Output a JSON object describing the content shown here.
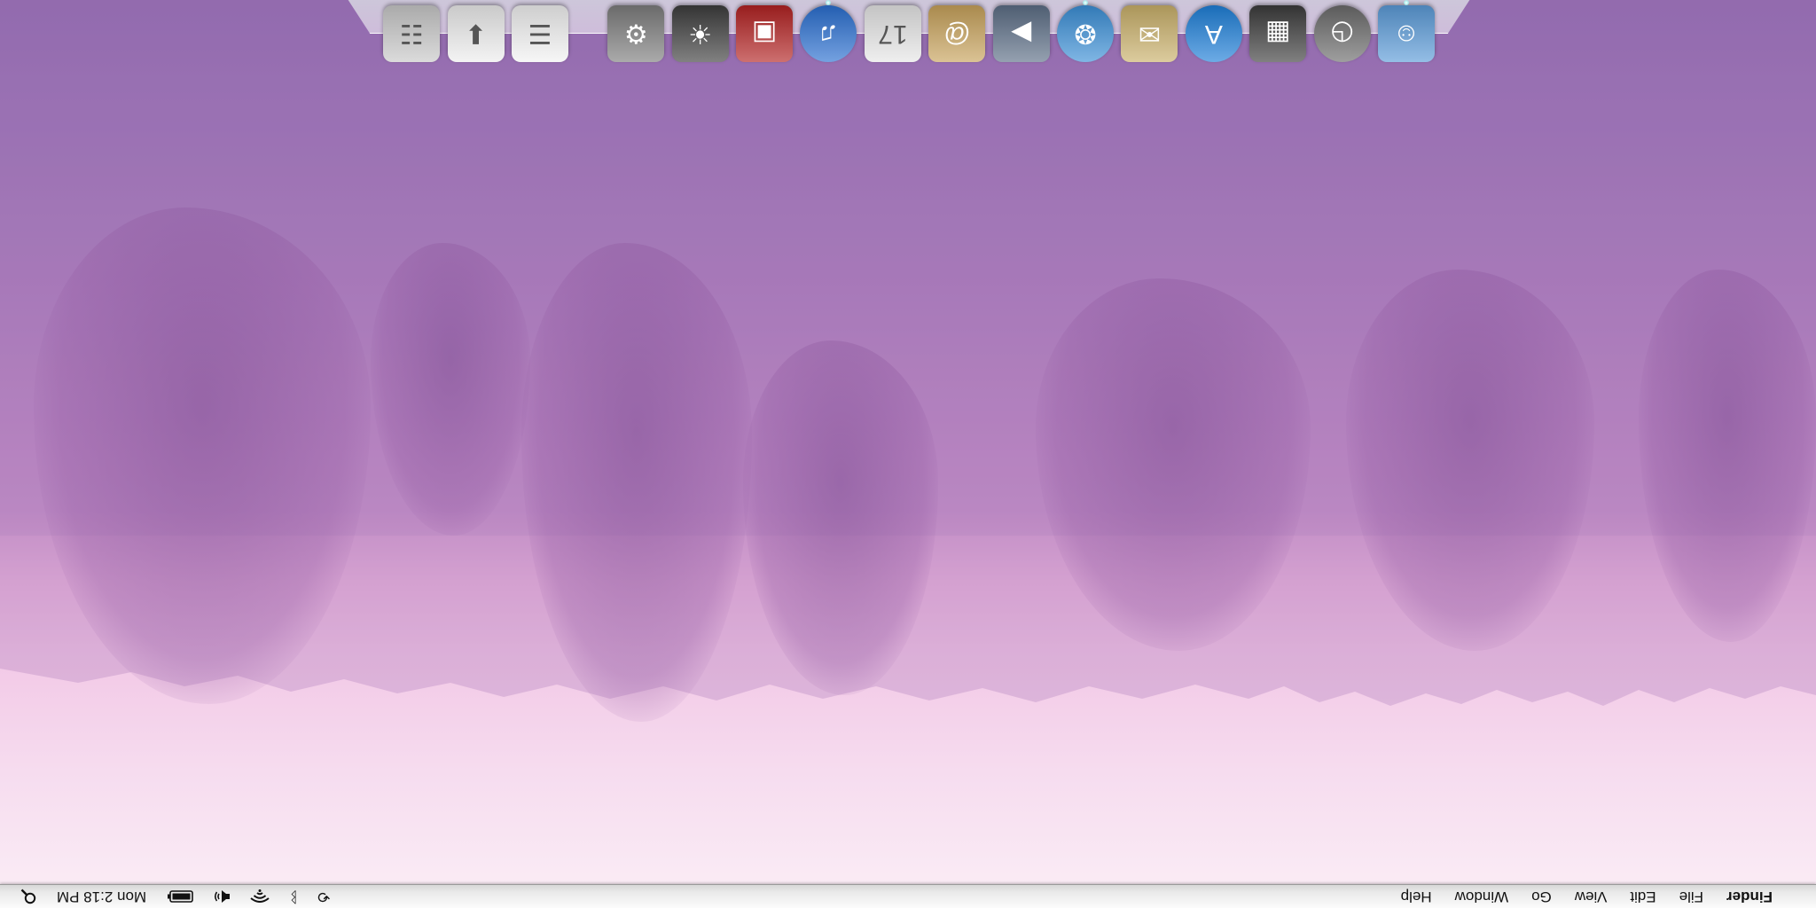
{
  "menubar": {
    "apple_glyph": "",
    "app_name": "Finder",
    "menus": [
      "File",
      "Edit",
      "View",
      "Go",
      "Window",
      "Help"
    ],
    "status": {
      "time_machine_glyph": "⟲",
      "bluetooth_glyph": "ᛒ",
      "wifi_glyph": "◡",
      "volume_glyph": "🔈",
      "battery_glyph": "▭",
      "clock": "Mon 2:18 PM",
      "spotlight_glyph": "⌕"
    }
  },
  "dock": {
    "apps": [
      {
        "name": "Finder",
        "glyph": "☺",
        "color": "#5b9bd8"
      },
      {
        "name": "Dashboard",
        "glyph": "◷",
        "color": "#6b6b6b"
      },
      {
        "name": "Mission Control",
        "glyph": "▦",
        "color": "#3c3c3c"
      },
      {
        "name": "App Store",
        "glyph": "A",
        "color": "#1e7fd8"
      },
      {
        "name": "Mail",
        "glyph": "✉",
        "color": "#c9b06a"
      },
      {
        "name": "Safari",
        "glyph": "❂",
        "color": "#3b8fd6"
      },
      {
        "name": "FaceTime",
        "glyph": "▶",
        "color": "#5c6e86"
      },
      {
        "name": "Contacts",
        "glyph": "@",
        "color": "#c7a25b"
      },
      {
        "name": "Calendar",
        "glyph": "17",
        "color": "#e6e6e6"
      },
      {
        "name": "iTunes",
        "glyph": "♫",
        "color": "#2a6fd0"
      },
      {
        "name": "Photo Booth",
        "glyph": "▣",
        "color": "#b22222"
      },
      {
        "name": "iPhoto",
        "glyph": "☀",
        "color": "#3d3d3d"
      },
      {
        "name": "System Preferences",
        "glyph": "⚙",
        "color": "#7d7d7d"
      }
    ],
    "docs": [
      {
        "name": "Documents stack",
        "glyph": "☰",
        "color": "#f2f2f2"
      },
      {
        "name": "Downloads stack",
        "glyph": "⬇",
        "color": "#ededed"
      },
      {
        "name": "Trash",
        "glyph": "☷",
        "color": "#c8c8c8"
      }
    ]
  }
}
